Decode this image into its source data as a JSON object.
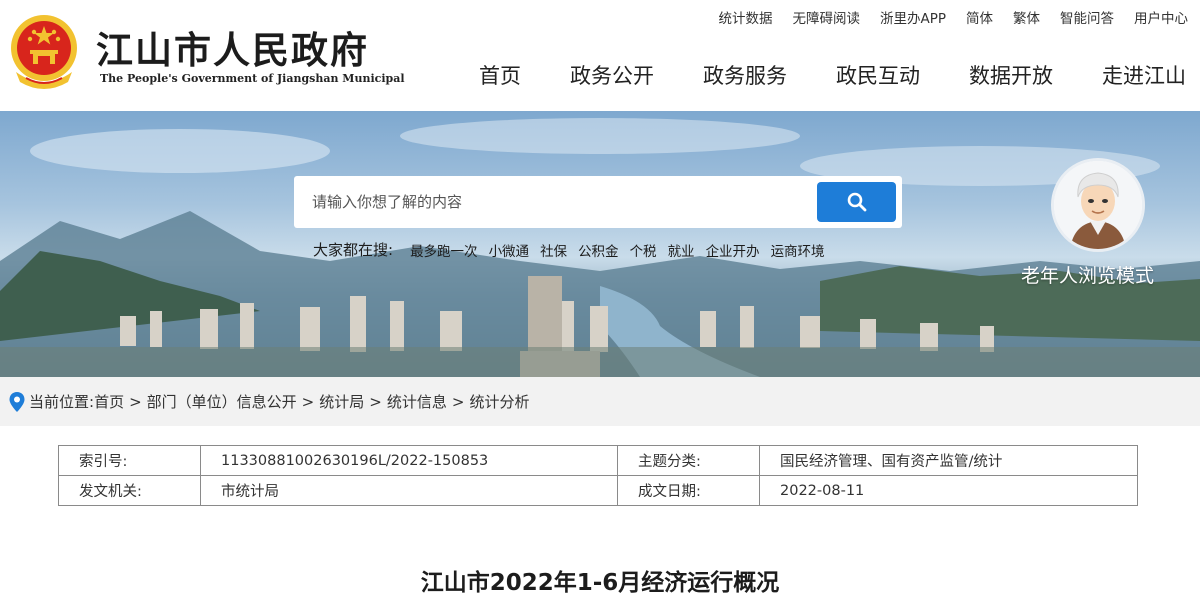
{
  "site": {
    "name": "江山市人民政府",
    "name_en": "The People's Government of Jiangshan Municipal"
  },
  "top_links": [
    "统计数据",
    "无障碍阅读",
    "浙里办APP",
    "简体",
    "繁体",
    "智能问答",
    "用户中心"
  ],
  "main_nav": [
    "首页",
    "政务公开",
    "政务服务",
    "政民互动",
    "数据开放",
    "走进江山"
  ],
  "search": {
    "placeholder": "请输入你想了解的内容",
    "hot_label": "大家都在搜:",
    "hot_items": [
      "最多跑一次",
      "小微通",
      "社保",
      "公积金",
      "个税",
      "就业",
      "企业开办",
      "运商环境"
    ]
  },
  "elder_mode": {
    "label": "老年人浏览模式"
  },
  "breadcrumb": {
    "prefix": "当前位置:",
    "items": [
      "首页",
      "部门（单位）信息公开",
      "统计局",
      "统计信息",
      "统计分析"
    ],
    "separator": ">"
  },
  "meta": {
    "index_label": "索引号:",
    "index_value": "11330881002630196L/2022-150853",
    "topic_label": "主题分类:",
    "topic_value": "国民经济管理、国有资产监管/统计",
    "issuer_label": "发文机关:",
    "issuer_value": "市统计局",
    "date_label": "成文日期:",
    "date_value": "2022-08-11"
  },
  "article": {
    "title": "江山市2022年1-6月经济运行概况"
  },
  "colors": {
    "accent": "#1e7dd8",
    "emblem_red": "#d8251c",
    "emblem_gold": "#f2c230"
  }
}
